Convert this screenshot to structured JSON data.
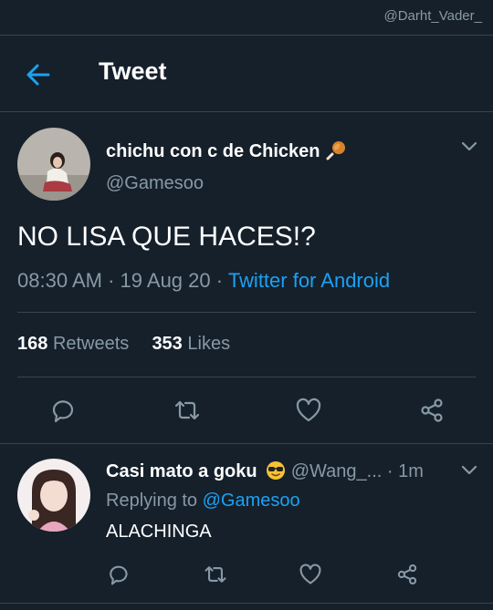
{
  "watermark": "@Darht_Vader_",
  "header": {
    "title": "Tweet"
  },
  "tweet": {
    "author_name": "chichu con c de Chicken",
    "author_emoji": "poultry-leg-icon",
    "handle": "@Gamesoo",
    "text": "NO LISA QUE HACES!?",
    "time": "08:30 AM",
    "date": "19 Aug 20",
    "source": "Twitter for Android",
    "retweets_count": "168",
    "retweets_label": "Retweets",
    "likes_count": "353",
    "likes_label": "Likes",
    "actions": [
      "reply-icon",
      "retweet-icon",
      "like-icon",
      "share-icon"
    ]
  },
  "reply": {
    "author_name": "Casi mato a goku",
    "author_emoji": "sunglasses-face-icon",
    "handle": "@Wang_...",
    "age": "1m",
    "replying_prefix": "Replying to",
    "replying_handle": "@Gamesoo",
    "text": "ALACHINGA"
  },
  "colors": {
    "background": "#15202b",
    "divider": "#38444d",
    "secondary_text": "#8899a6",
    "accent": "#1da1f2"
  }
}
